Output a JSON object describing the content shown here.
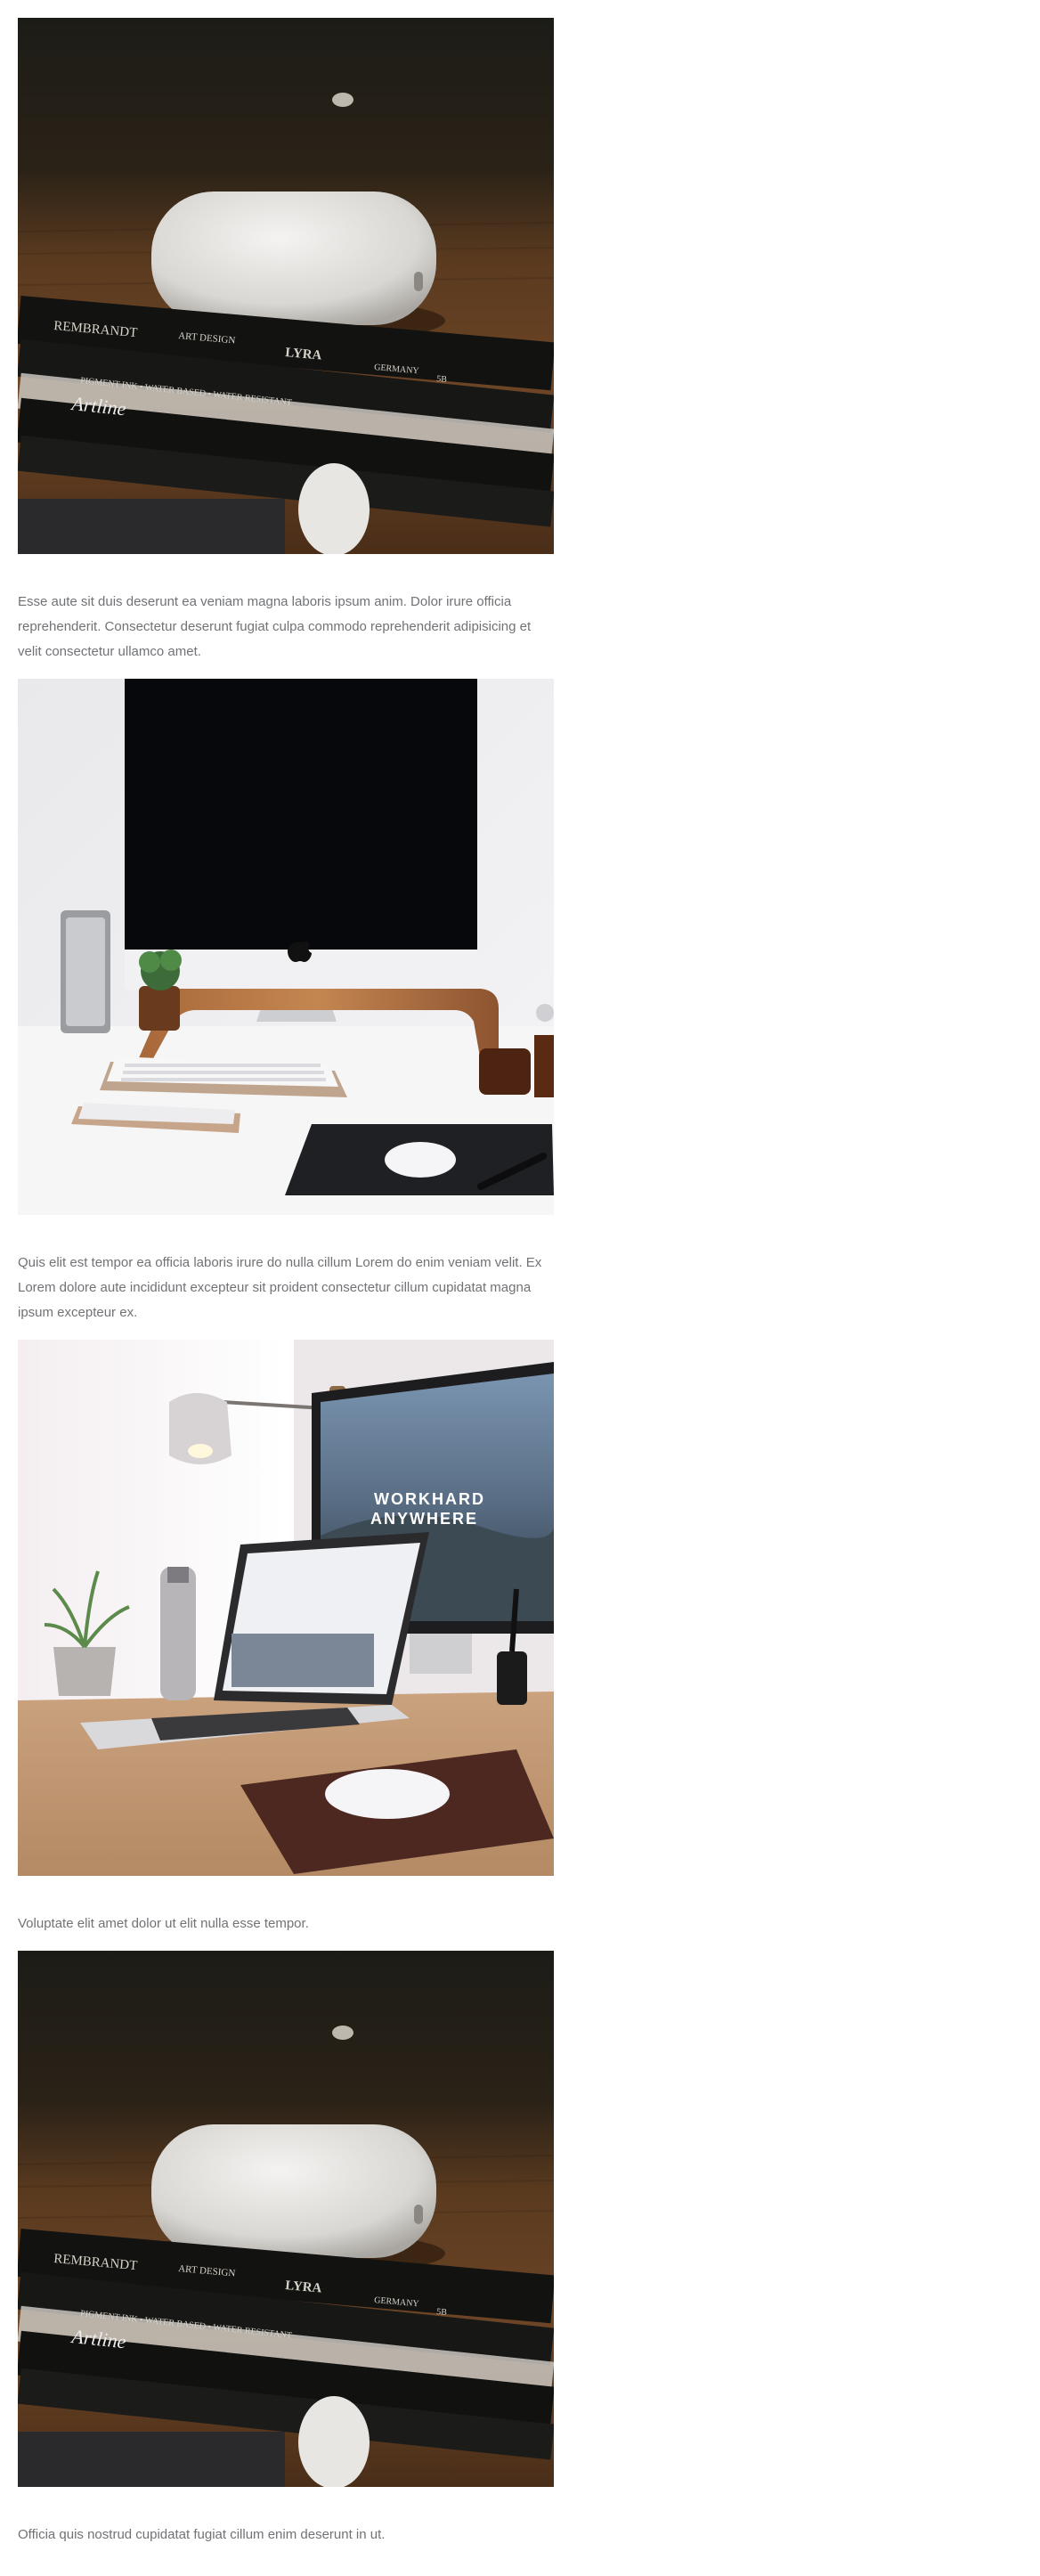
{
  "posts": [
    {
      "image_subject": "airpods-case-on-wooden-desk-with-markers",
      "caption": "Esse aute sit duis deserunt ea veniam magna laboris ipsum anim. Dolor irure officia reprehenderit. Consectetur deserunt fugiat culpa commodo reprehenderit adipisicing et velit consectetur ullamco amet.",
      "marker_texts": [
        "REMBRANDT",
        "ART DESIGN",
        "LYRA",
        "GERMANY",
        "5B",
        "PIGMENT INK • WATER BASED • WATER RESISTANT",
        "Artline"
      ]
    },
    {
      "image_subject": "imac-on-wooden-stand-with-keyboard-and-mouse",
      "caption": "Quis elit est tempor ea officia laboris irure do nulla cillum Lorem do enim veniam velit. Ex Lorem dolore aute incididunt excepteur sit proident consectetur cillum cupidatat magna ipsum excepteur ex."
    },
    {
      "image_subject": "laptop-and-monitor-workspace-with-lamp",
      "caption": "Voluptate elit amet dolor ut elit nulla esse tempor.",
      "monitor_text": [
        "WORKHARD",
        "ANYWHERE"
      ]
    },
    {
      "image_subject": "airpods-case-on-wooden-desk-with-markers",
      "caption": "Officia quis nostrud cupidatat fugiat cillum enim deserunt in ut.",
      "marker_texts": [
        "REMBRANDT",
        "ART DESIGN",
        "LYRA",
        "GERMANY",
        "5B",
        "PIGMENT INK • WATER BASED • WATER RESISTANT",
        "Artline"
      ]
    }
  ],
  "colors": {
    "caption_text": "#707276",
    "background": "#ffffff",
    "desk_wood": "#6b4424",
    "dark_bg": "#1a1a16"
  }
}
